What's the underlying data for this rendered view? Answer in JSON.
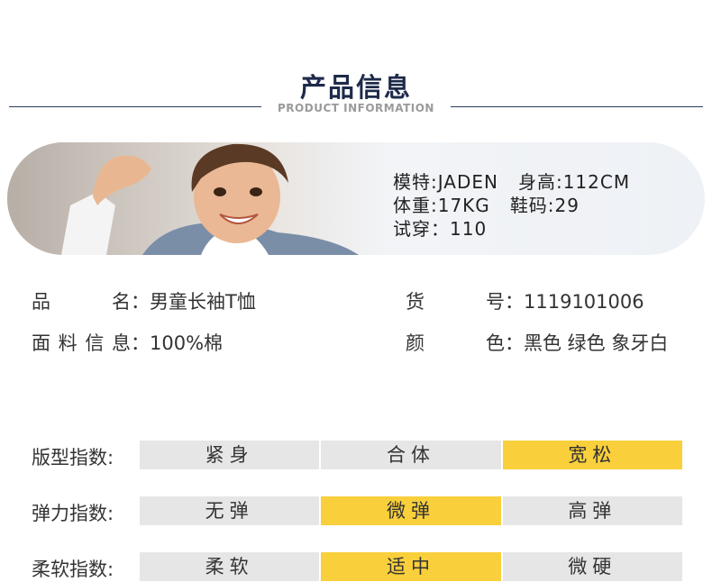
{
  "section": {
    "title": "产品信息",
    "subtitle": "PRODUCT INFORMATION"
  },
  "model": {
    "name": "模特:JADEN",
    "height": "身高:112CM",
    "weight": "体重:17KG",
    "shoe": "鞋码:29",
    "trial": "试穿：110"
  },
  "product": {
    "name_label": "品  名",
    "name_value": "男童长袖T恤",
    "sku_label": "货  号",
    "sku_value": "1119101006",
    "fabric_label": "面料信息",
    "fabric_value": "100%棉",
    "color_label": "颜  色",
    "color_value": "黑色 绿色 象牙白"
  },
  "indices": [
    {
      "label": "版型指数:",
      "options": [
        "紧身",
        "合体",
        "宽松"
      ],
      "selected": 2
    },
    {
      "label": "弹力指数:",
      "options": [
        "无弹",
        "微弹",
        "高弹"
      ],
      "selected": 1
    },
    {
      "label": "柔软指数:",
      "options": [
        "柔软",
        "适中",
        "微硬"
      ],
      "selected": 1
    }
  ],
  "colors": {
    "highlight": "#f9cf3b",
    "neutral": "#e6e6e6",
    "navy": "#1d2a4a"
  }
}
